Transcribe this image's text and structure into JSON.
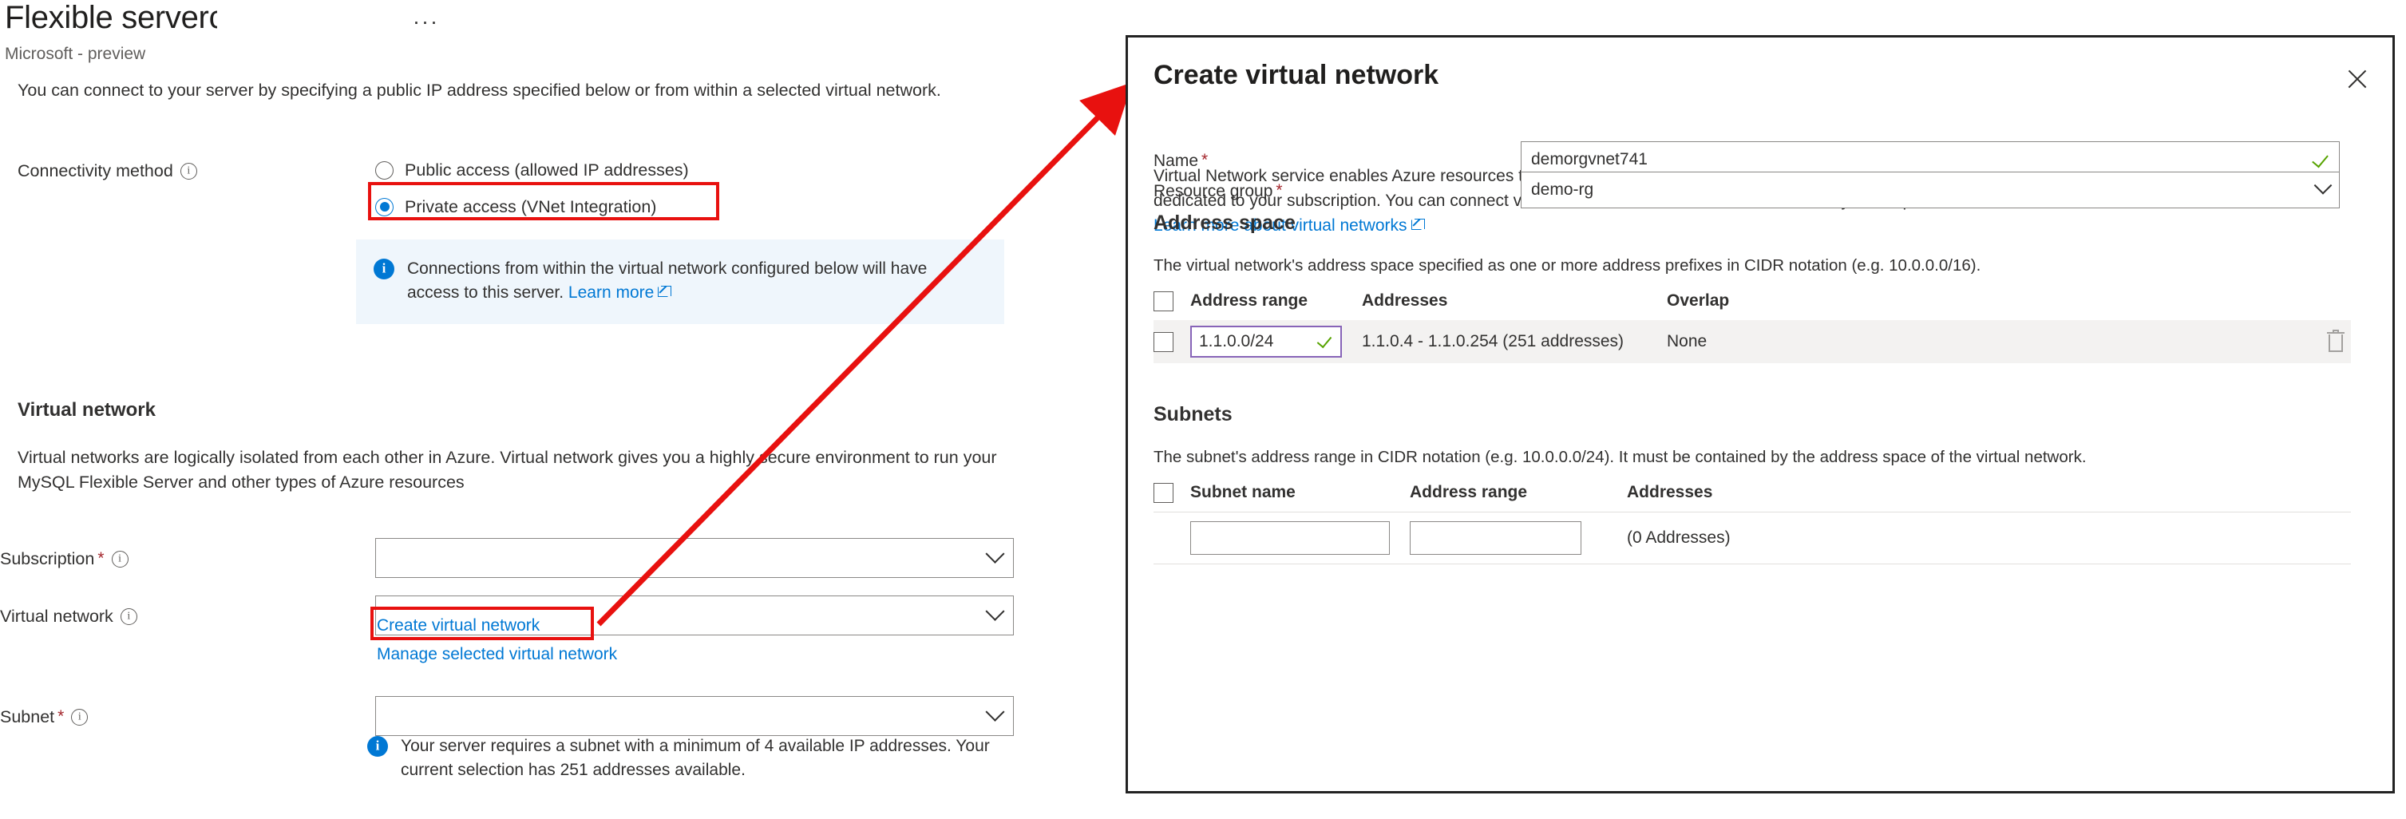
{
  "left": {
    "title": "Flexible server",
    "title_cut_char": "c",
    "ellipsis": "···",
    "subtitle": "Microsoft - preview",
    "intro": "You can connect to your server by specifying a public IP address specified below or from within a selected virtual network.",
    "connectivity": {
      "label": "Connectivity method",
      "info_icon": "info-icon",
      "options": [
        {
          "label": "Public access (allowed IP addresses)",
          "selected": false
        },
        {
          "label": "Private access (VNet Integration)",
          "selected": true
        }
      ],
      "highlight_color": "#e8110f"
    },
    "banner": {
      "icon": "info-icon",
      "text": "Connections from within the virtual network configured below will have access to this server.",
      "link": "Learn more",
      "link_icon": "external-link-icon",
      "background": "#eff6fc"
    },
    "vnet_section": {
      "heading": "Virtual network",
      "description": "Virtual networks are logically isolated from each other in Azure. Virtual network gives you a highly secure environment to run your MySQL Flexible Server and other types of Azure resources"
    },
    "fields": {
      "subscription_label": "Subscription",
      "subscription_value": "",
      "virtual_network_label": "Virtual network",
      "virtual_network_value": "",
      "subnet_label": "Subnet",
      "subnet_value": "",
      "required_mark": "*",
      "chevron": "chevron-down-icon"
    },
    "vnet_links": {
      "create": "Create virtual network",
      "manage": "Manage selected virtual network"
    },
    "subnet_note": {
      "icon": "info-icon",
      "text": "Your server requires a subnet with a minimum of 4 available IP addresses. Your current selection has 251 addresses available."
    }
  },
  "dialog": {
    "title": "Create virtual network",
    "close_icon": "close-icon",
    "description": "Virtual Network service enables Azure resources to securely communicate with each other in a virtual network which is a logical isolation of the Azure cloud dedicated to your subscription. You can connect virtual networks to other virtual networks, or your on-premises network.",
    "learn_more": "Learn more about virtual networks",
    "learn_more_icon": "external-link-icon",
    "name": {
      "label": "Name",
      "required": "*",
      "value": "demorgvnet741",
      "validation_icon": "checkmark-icon"
    },
    "resource_group": {
      "label": "Resource group",
      "required": "*",
      "value": "demo-rg",
      "chevron": "chevron-down-icon"
    },
    "address_space": {
      "heading": "Address space",
      "description": "The virtual network's address space specified as one or more address prefixes in CIDR notation (e.g. 10.0.0.0/16).",
      "columns": [
        "Address range",
        "Addresses",
        "Overlap"
      ],
      "rows": [
        {
          "range": "1.1.0.0/24",
          "range_valid_icon": "checkmark-icon",
          "addresses": "1.1.0.4 - 1.1.0.254 (251 addresses)",
          "overlap": "None",
          "delete_icon": "trash-icon"
        }
      ]
    },
    "subnets": {
      "heading": "Subnets",
      "description": "The subnet's address range in CIDR notation (e.g. 10.0.0.0/24). It must be contained by the address space of the virtual network.",
      "columns": [
        "Subnet name",
        "Address range",
        "Addresses"
      ],
      "rows": [
        {
          "name": "",
          "range": "",
          "addresses": "(0 Addresses)"
        }
      ]
    }
  },
  "annotation": {
    "arrow_color": "#e8110f",
    "arrow_label": "pointer-arrow-from-create-vnet-link-to-dialog"
  }
}
